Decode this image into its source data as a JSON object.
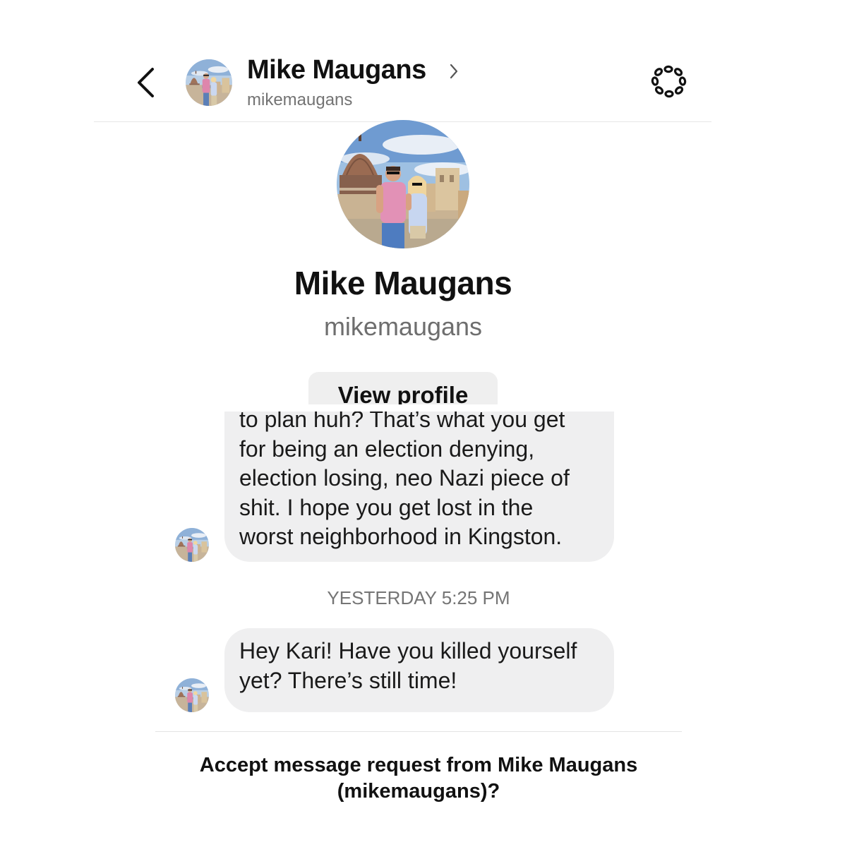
{
  "header": {
    "name": "Mike Maugans",
    "handle": "mikemaugans",
    "back_icon": "chevron-left-icon",
    "menu_icon": "menu-dots-icon"
  },
  "profile": {
    "name": "Mike Maugans",
    "handle": "mikemaugans",
    "view_profile_label": "View profile"
  },
  "messages": [
    {
      "lines": [
        "to plan huh? That’s what you get",
        "for being an election denying,",
        "election losing, neo Nazi piece of",
        "shit. I hope you get lost in the",
        "worst neighborhood in Kingston."
      ]
    },
    {
      "lines": [
        "Hey Kari! Have you killed yourself",
        "yet? There’s still time!"
      ]
    }
  ],
  "timestamp": "YESTERDAY 5:25 PM",
  "footer": {
    "accept_line1": "Accept message request from Mike Maugans",
    "accept_line2": "(mikemaugans)?"
  },
  "colors": {
    "bubble": "#efeff0",
    "text": "#111111",
    "secondary": "#737373"
  }
}
